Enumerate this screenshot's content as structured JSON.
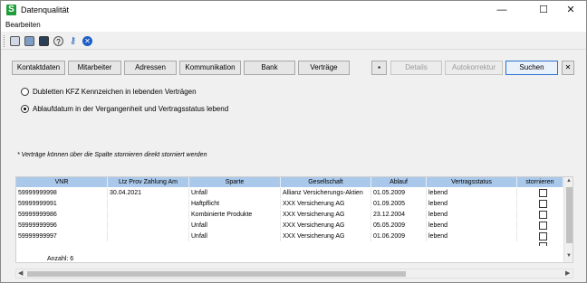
{
  "window": {
    "title": "Datenqualität",
    "app_icon_letter": "S"
  },
  "window_controls": {
    "minimize": "—",
    "maximize": "☐",
    "close": "✕"
  },
  "menu": {
    "edit": "Bearbeiten"
  },
  "toolbar_icons": [
    "save-icon",
    "print-icon",
    "screen-icon",
    "help-icon",
    "key-icon",
    "close-circle-icon"
  ],
  "buttons": {
    "kontaktdaten": "Kontaktdaten",
    "mitarbeiter": "Mitarbeiter",
    "adressen": "Adressen",
    "kommunikation": "Kommunikation",
    "bank": "Bank",
    "vertraege": "Verträge",
    "details": "Details",
    "autokorrektur": "Autokorrektur",
    "suchen": "Suchen",
    "close_x": "✕"
  },
  "options": {
    "dubletten": "Dubletten  KFZ Kennzeichen in lebenden Verträgen",
    "ablauf": "Ablaufdatum in der Vergangenheit und Vertragsstatus lebend",
    "selected": "ablauf"
  },
  "note": "* Verträge können über die Spalte stornieren direkt storniert werden",
  "table": {
    "columns": [
      "VNR",
      "Ltz Prov Zahlung Am",
      "Sparte",
      "Gesellschaft",
      "Ablauf",
      "Vertragsstatus",
      "stornieren"
    ],
    "rows": [
      [
        "59999999998",
        "30.04.2021",
        "Unfall",
        "Allianz Versicherungs-Aktien",
        "01.05.2009",
        "lebend"
      ],
      [
        "59999999991",
        "",
        "Haftpflicht",
        "XXX Versicherung AG",
        "01.09.2005",
        "lebend"
      ],
      [
        "59999999986",
        "",
        "Kombinierte Produkte",
        "XXX Versicherung AG",
        "23.12.2004",
        "lebend"
      ],
      [
        "59999999996",
        "",
        "Unfall",
        "XXX Versicherung AG",
        "05.05.2009",
        "lebend"
      ],
      [
        "59999999997",
        "",
        "Unfall",
        "XXX Versicherung AG",
        "01.06.2009",
        "lebend"
      ]
    ],
    "count_label": "Anzahl: 6"
  }
}
